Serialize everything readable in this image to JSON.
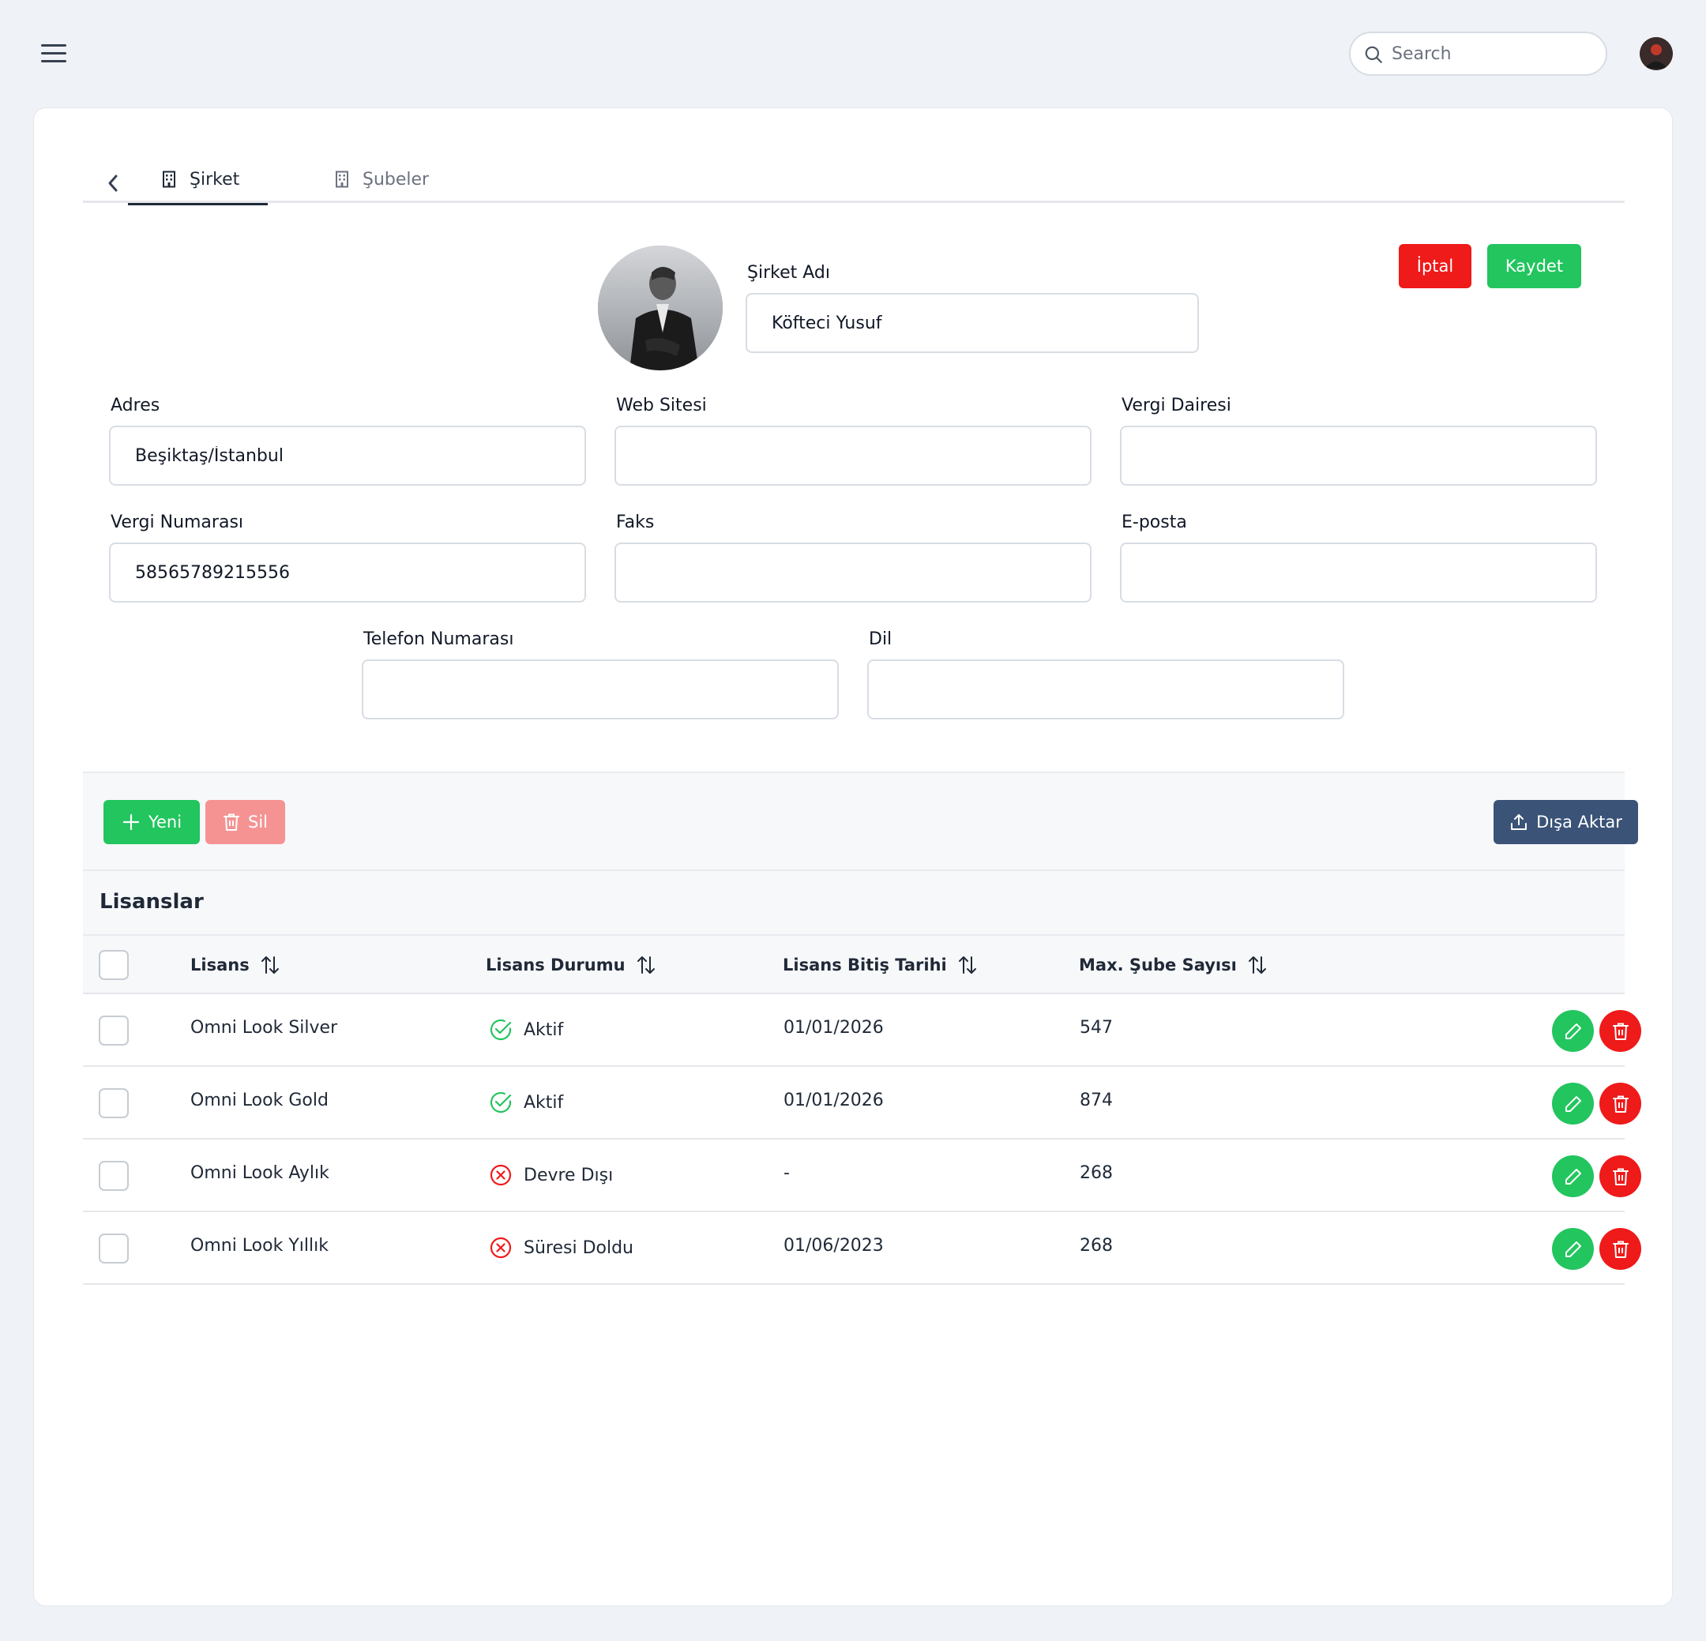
{
  "header": {
    "search_placeholder": "Search"
  },
  "tabs": [
    {
      "label": "Şirket",
      "icon": "building-icon",
      "active": true
    },
    {
      "label": "Şubeler",
      "icon": "building-icon",
      "active": false
    }
  ],
  "form": {
    "company_name_label": "Şirket Adı",
    "company_name_value": "Köfteci Yusuf",
    "address_label": "Adres",
    "address_value": "Beşiktaş/İstanbul",
    "website_label": "Web Sitesi",
    "website_value": "",
    "tax_office_label": "Vergi Dairesi",
    "tax_office_value": "",
    "tax_number_label": "Vergi Numarası",
    "tax_number_value": "58565789215556",
    "fax_label": "Faks",
    "fax_value": "",
    "email_label": "E-posta",
    "email_value": "",
    "phone_label": "Telefon Numarası",
    "phone_value": "",
    "language_label": "Dil",
    "language_value": ""
  },
  "actions": {
    "cancel_label": "İptal",
    "save_label": "Kaydet"
  },
  "toolbar": {
    "new_label": "Yeni",
    "delete_label": "Sil",
    "export_label": "Dışa Aktar"
  },
  "licenses": {
    "title": "Lisanslar",
    "columns": [
      "Lisans",
      "Lisans Durumu",
      "Lisans Bitiş Tarihi",
      "Max. Şube Sayısı"
    ],
    "rows": [
      {
        "name": "Omni Look Silver",
        "status": "Aktif",
        "status_type": "active",
        "end_date": "01/01/2026",
        "max_branches": "547"
      },
      {
        "name": "Omni Look Gold",
        "status": "Aktif",
        "status_type": "active",
        "end_date": "01/01/2026",
        "max_branches": "874"
      },
      {
        "name": "Omni Look Aylık",
        "status": "Devre Dışı",
        "status_type": "inactive",
        "end_date": "-",
        "max_branches": "268"
      },
      {
        "name": "Omni Look Yıllık",
        "status": "Süresi Doldu",
        "status_type": "inactive",
        "end_date": "01/06/2023",
        "max_branches": "268"
      }
    ]
  },
  "colors": {
    "success": "#22c55e",
    "danger": "#ef1a1a",
    "danger_light": "#f59393",
    "export": "#3a5377",
    "background": "#eff2f6"
  }
}
